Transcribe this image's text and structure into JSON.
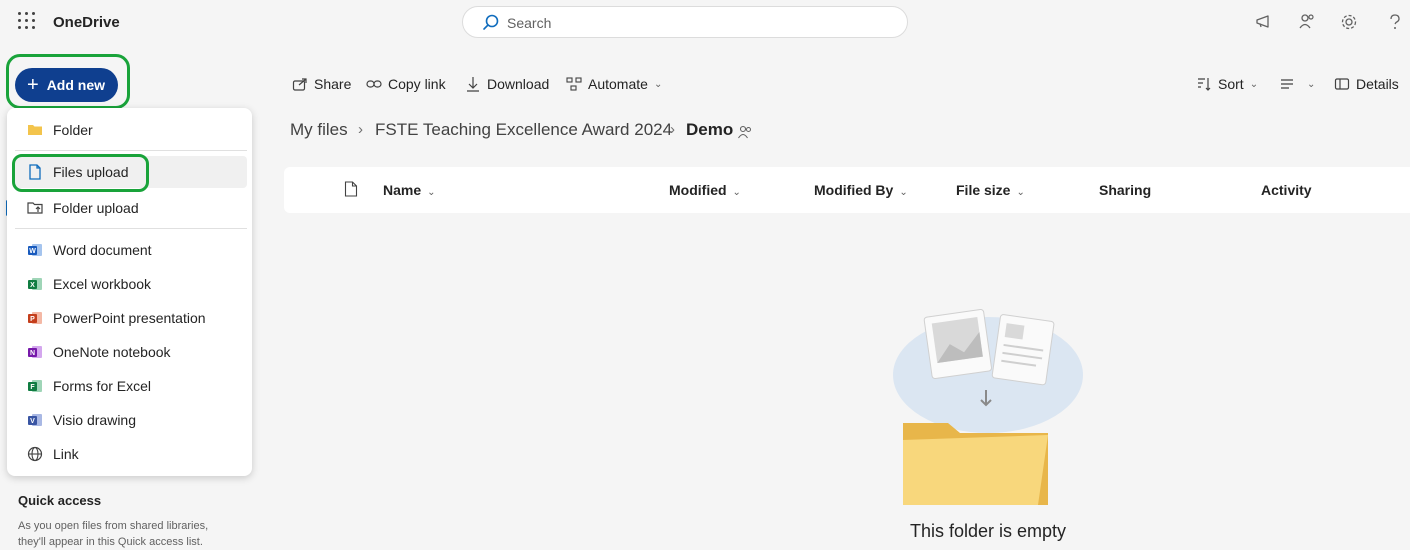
{
  "app": {
    "title": "OneDrive"
  },
  "search": {
    "placeholder": "Search"
  },
  "add_new": {
    "label": "Add new"
  },
  "menu": {
    "items": [
      {
        "label": "Folder",
        "icon": "folder-icon"
      },
      {
        "label": "Files upload",
        "icon": "file-upload-icon"
      },
      {
        "label": "Folder upload",
        "icon": "folder-upload-icon"
      },
      {
        "label": "Word document",
        "icon": "word-icon"
      },
      {
        "label": "Excel workbook",
        "icon": "excel-icon"
      },
      {
        "label": "PowerPoint presentation",
        "icon": "powerpoint-icon"
      },
      {
        "label": "OneNote notebook",
        "icon": "onenote-icon"
      },
      {
        "label": "Forms for Excel",
        "icon": "forms-icon"
      },
      {
        "label": "Visio drawing",
        "icon": "visio-icon"
      },
      {
        "label": "Link",
        "icon": "globe-icon"
      }
    ]
  },
  "quick_access": {
    "title": "Quick access",
    "text": "As you open files from shared libraries, they'll appear in this Quick access list."
  },
  "commands": {
    "share": "Share",
    "copy_link": "Copy link",
    "download": "Download",
    "automate": "Automate",
    "sort": "Sort",
    "details": "Details"
  },
  "breadcrumb": {
    "root": "My files",
    "folder": "FSTE Teaching Excellence Award 2024",
    "current": "Demo"
  },
  "columns": {
    "name": "Name",
    "modified": "Modified",
    "modified_by": "Modified By",
    "file_size": "File size",
    "sharing": "Sharing",
    "activity": "Activity"
  },
  "empty_state": {
    "text": "This folder is empty"
  },
  "colors": {
    "accent": "#0f3f8f",
    "highlight_ring": "#19a33a",
    "word": "#185abd",
    "excel": "#107c41",
    "powerpoint": "#c43e1c",
    "onenote": "#7719aa",
    "visio": "#3955a3",
    "folder": "#f3c44c"
  }
}
